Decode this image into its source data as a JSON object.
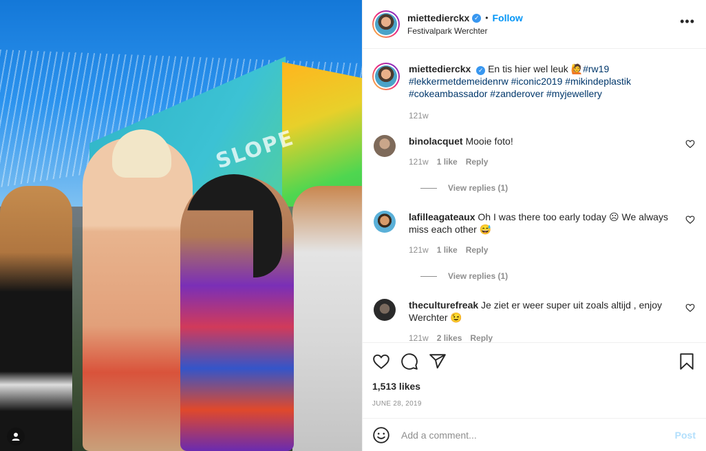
{
  "header": {
    "username": "miettedierckx",
    "separator": "•",
    "follow_label": "Follow",
    "location": "Festivalpark Werchter",
    "more_label": "•••"
  },
  "photo": {
    "stage_label": "SLOPE"
  },
  "caption": {
    "username": "miettedierckx",
    "text": "En tis hier wel leuk 🙋",
    "hashtags": [
      "#rw19",
      "#lekkermetdemeidenrw",
      "#iconic2019",
      "#mikindeplastik",
      "#cokeambassador",
      "#zanderover",
      "#myjewellery"
    ],
    "timestamp": "121w"
  },
  "comments": [
    {
      "username": "binolacquet",
      "text": "Mooie foto!",
      "time": "121w",
      "likes": "1 like",
      "reply_label": "Reply",
      "view_replies": "View replies (1)"
    },
    {
      "username": "lafilleagateaux",
      "text": "Oh I was there too early today ☹ We always miss each other 😅",
      "time": "121w",
      "likes": "1 like",
      "reply_label": "Reply",
      "view_replies": "View replies (1)"
    },
    {
      "username": "theculturefreak",
      "text": "Je ziet er weer super uit zoals altijd , enjoy Werchter 😉",
      "time": "121w",
      "likes": "2 likes",
      "reply_label": "Reply"
    }
  ],
  "actions": {
    "likes": "1,513 likes",
    "date": "JUNE 28, 2019"
  },
  "add_comment": {
    "placeholder": "Add a comment...",
    "post_label": "Post"
  },
  "colors": {
    "link_blue": "#0095f6",
    "hashtag": "#00376b",
    "muted": "#8e8e8e",
    "post_disabled": "#b2dffc"
  },
  "icons": [
    "verified-icon",
    "more-options-icon",
    "heart-icon",
    "comment-icon",
    "share-icon",
    "bookmark-icon",
    "emoji-icon",
    "user-tag-icon"
  ]
}
